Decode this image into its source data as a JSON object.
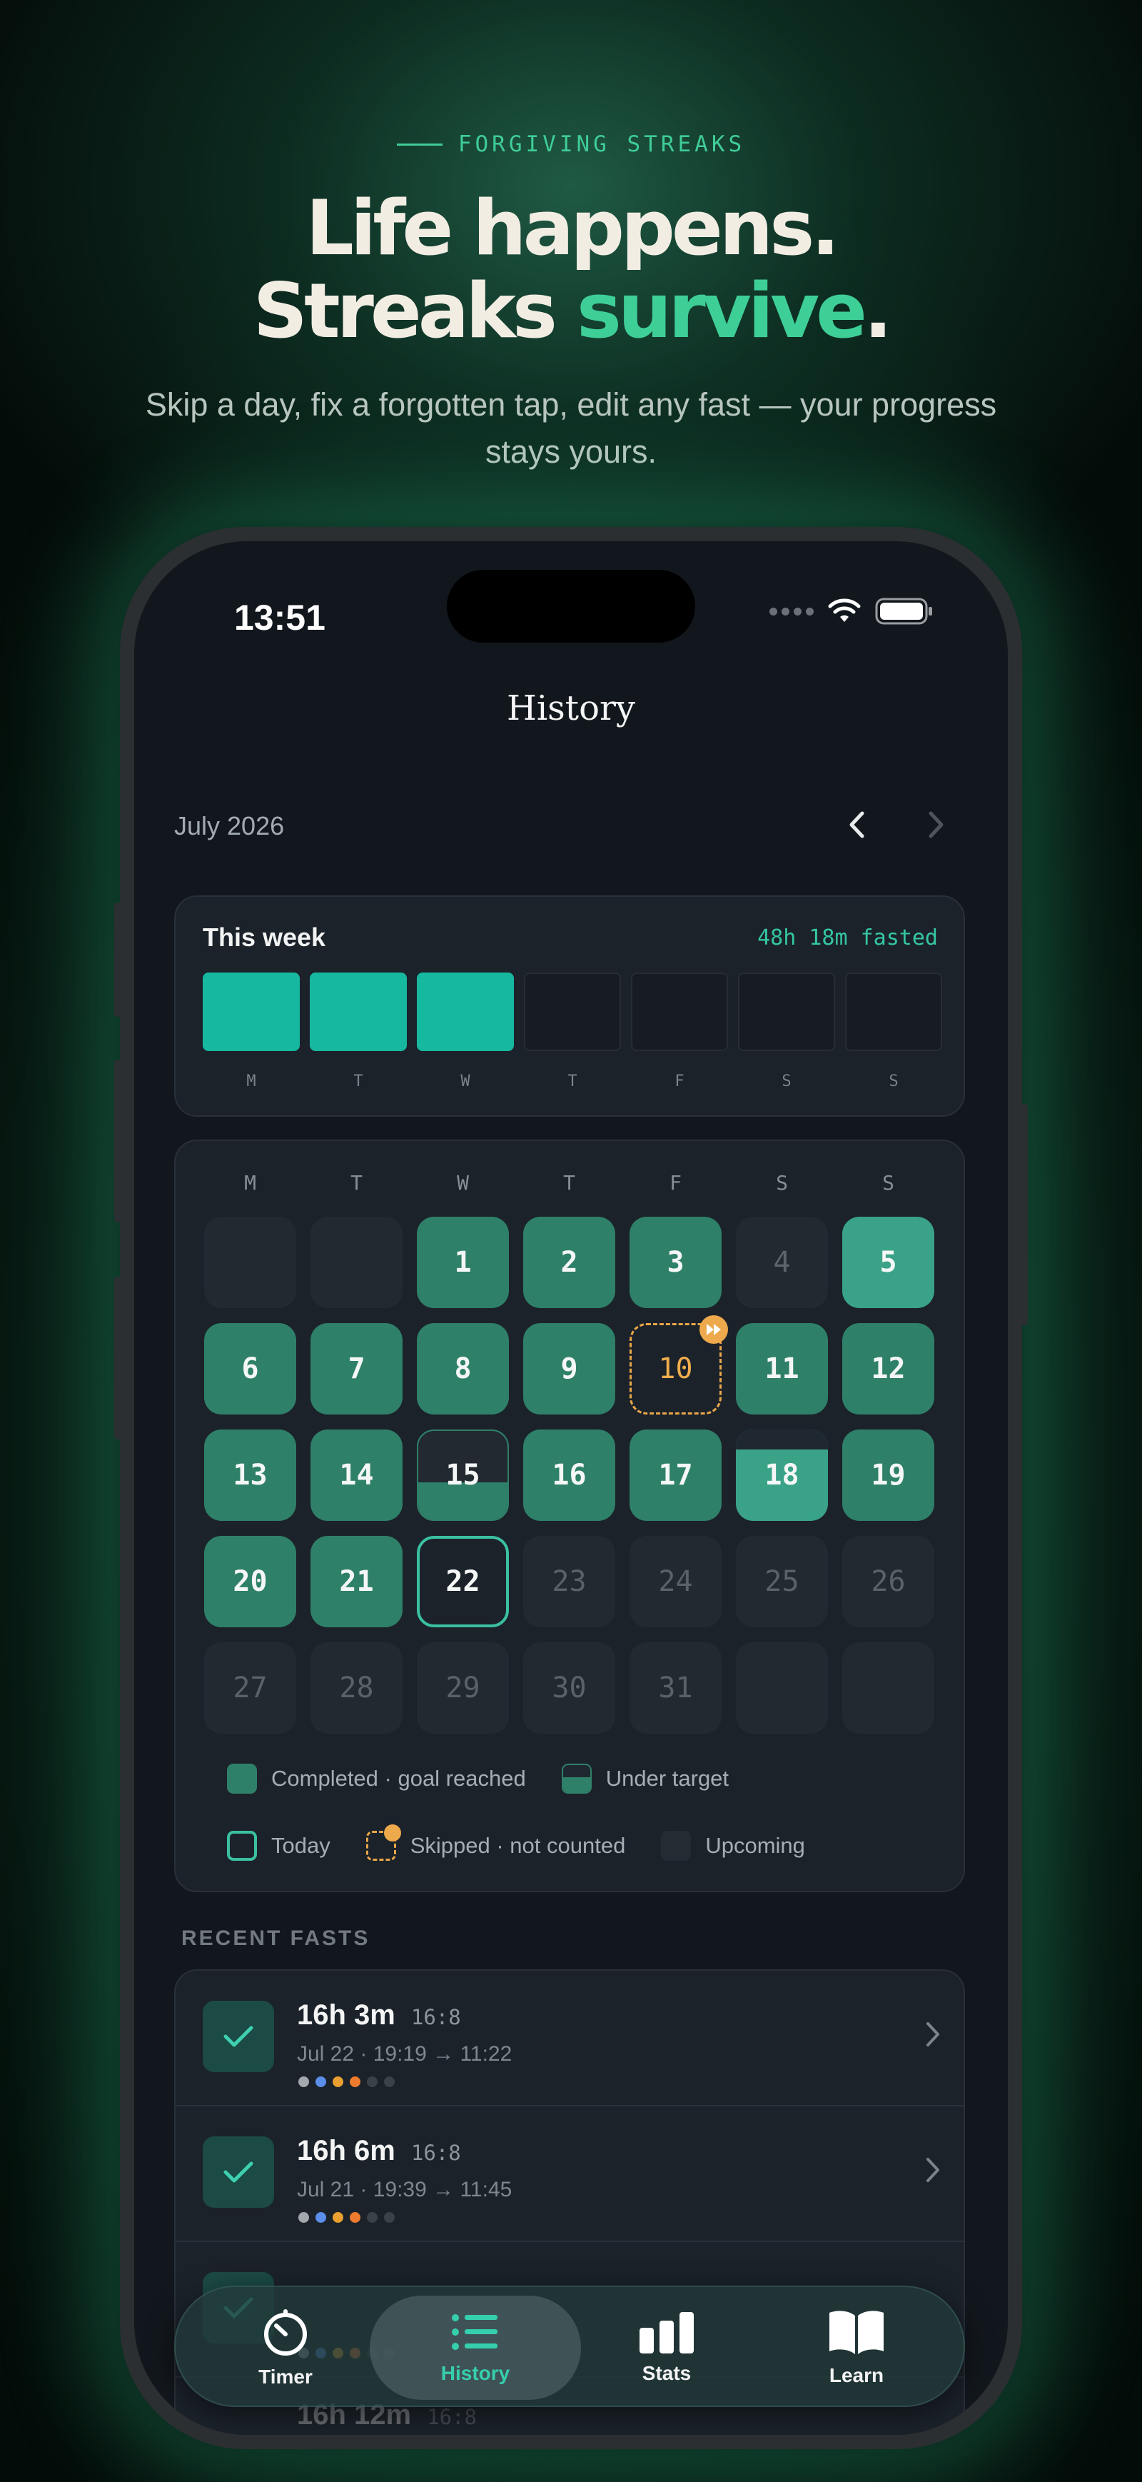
{
  "hero": {
    "eyebrow": "FORGIVING STREAKS",
    "headline_line1": "Life happens.",
    "headline_line2_a": "Streaks ",
    "headline_line2_accent": "survive",
    "headline_line2_b": ".",
    "subhead": "Skip a day, fix a forgotten tap, edit any fast — your progress stays yours."
  },
  "status_bar": {
    "time": "13:51"
  },
  "screen": {
    "title": "History",
    "month": "July 2026"
  },
  "this_week": {
    "title": "This week",
    "total": "48h 18m fasted",
    "days": [
      {
        "label": "M",
        "done": true
      },
      {
        "label": "T",
        "done": true
      },
      {
        "label": "W",
        "done": true
      },
      {
        "label": "T",
        "done": false
      },
      {
        "label": "F",
        "done": false
      },
      {
        "label": "S",
        "done": false
      },
      {
        "label": "S",
        "done": false
      }
    ]
  },
  "calendar": {
    "weekday_labels": [
      "M",
      "T",
      "W",
      "T",
      "F",
      "S",
      "S"
    ],
    "days": {
      "d1": "1",
      "d2": "2",
      "d3": "3",
      "d4": "4",
      "d5": "5",
      "d6": "6",
      "d7": "7",
      "d8": "8",
      "d9": "9",
      "d10": "10",
      "d11": "11",
      "d12": "12",
      "d13": "13",
      "d14": "14",
      "d15": "15",
      "d16": "16",
      "d17": "17",
      "d18": "18",
      "d19": "19",
      "d20": "20",
      "d21": "21",
      "d22": "22",
      "d23": "23",
      "d24": "24",
      "d25": "25",
      "d26": "26",
      "d27": "27",
      "d28": "28",
      "d29": "29",
      "d30": "30",
      "d31": "31"
    },
    "legend": {
      "completed": "Completed · goal reached",
      "under": "Under target",
      "today": "Today",
      "skipped": "Skipped · not counted",
      "upcoming": "Upcoming"
    }
  },
  "recent": {
    "title": "RECENT FASTS",
    "items": [
      {
        "duration": "16h 3m",
        "protocol": "16:8",
        "meta": "Jul 22 · 19:19 → 11:22"
      },
      {
        "duration": "16h 6m",
        "protocol": "16:8",
        "meta": "Jul 21 · 19:39 → 11:45"
      },
      {
        "duration": "",
        "protocol": "",
        "meta": ""
      },
      {
        "duration": "16h 12m",
        "protocol": "16:8",
        "meta": ""
      }
    ]
  },
  "tabs": [
    {
      "label": "Timer",
      "icon": "timer-icon"
    },
    {
      "label": "History",
      "icon": "list-icon"
    },
    {
      "label": "Stats",
      "icon": "bar-chart-icon"
    },
    {
      "label": "Learn",
      "icon": "book-icon"
    }
  ],
  "colors": {
    "accent": "#3ecf97",
    "completed": "#2f8068",
    "week_bar": "#16b8a0",
    "skipped": "#e9a64a",
    "today_border": "#3ac0a0"
  }
}
